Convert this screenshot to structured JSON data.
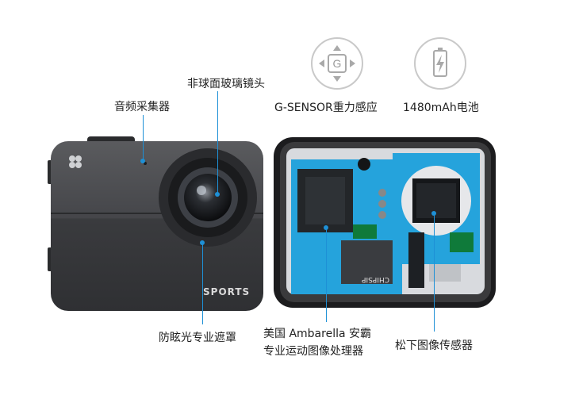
{
  "labels": {
    "audio": "音频采集器",
    "lens": "非球面玻璃镜头",
    "gsensor": "G-SENSOR重力感应",
    "battery": "1480mAh电池",
    "mask": "防眩光专业遮罩",
    "processor_line1": "美国 Ambarella 安霸",
    "processor_line2": "专业运动图像处理器",
    "sensor": "松下图像传感器"
  },
  "camera": {
    "brand_text": "SPORTS",
    "chip_text": "CHIPSIP"
  },
  "icons": {
    "gsensor_letter": "G",
    "gsensor_icon": "dpad-g-icon",
    "battery_icon": "battery-lightning-icon"
  },
  "colors": {
    "accent": "#1e90d6",
    "pcb": "#25a3dc",
    "camera_body": "#4a4b4e"
  }
}
